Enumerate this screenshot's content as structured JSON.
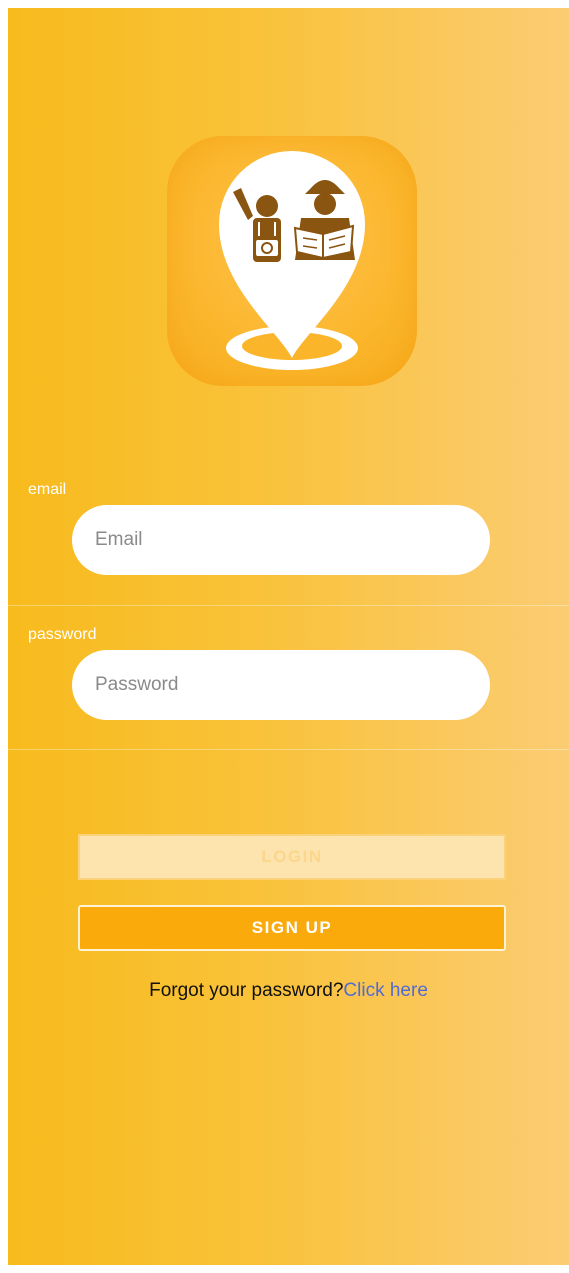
{
  "login_form": {
    "email": {
      "label": "email",
      "placeholder": "Email",
      "value": ""
    },
    "password": {
      "label": "password",
      "placeholder": "Password",
      "value": ""
    },
    "login_button": "LOGIN",
    "signup_button": "SIGN UP",
    "forgot_text": "Forgot your password?",
    "forgot_link": "Click here"
  },
  "logo": {
    "icon": "location-pin-travelers-icon"
  },
  "colors": {
    "background_start": "#f8bb1d",
    "background_end": "#fbcc73",
    "login_button_bg": "#fde3ad",
    "signup_button_bg": "#fbaa0c",
    "link": "#4f6bd4",
    "logo_figure": "#8a5411"
  }
}
